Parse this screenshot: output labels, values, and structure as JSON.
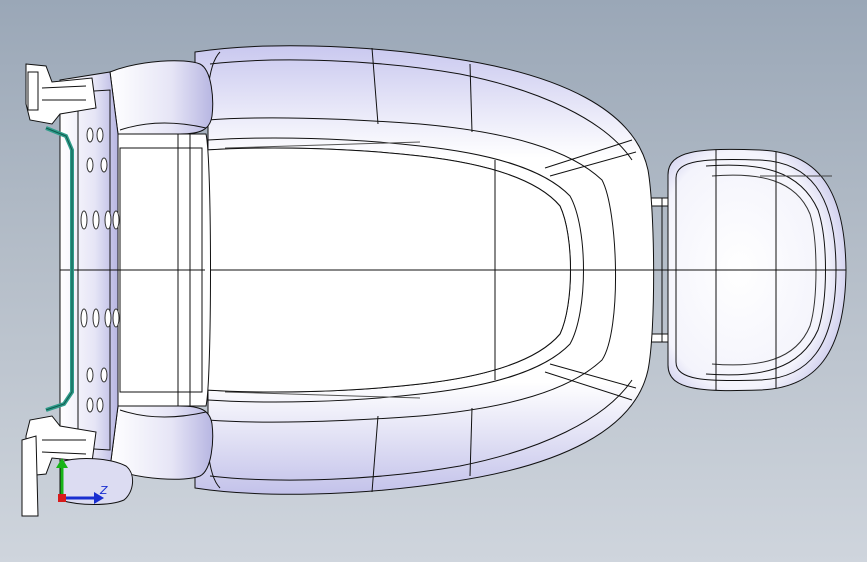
{
  "viewport": {
    "background_top": "#9aa7b7",
    "background_bottom": "#cfd5dd",
    "surface_fill": "#ffffff",
    "shade_color": "#b9b8e6",
    "edge_color": "#111111",
    "accent_teal": "#2f9c8a"
  },
  "model": {
    "parts": [
      "seat-frame",
      "seat-cushion",
      "cushion-bolster",
      "headrest",
      "headrest-posts"
    ],
    "icon": "seat-cad-model"
  },
  "triad": {
    "icon": "coordinate-triad-icon",
    "x_color": "#d81b1b",
    "y_color": "#18b418",
    "z_color": "#1a2fd0",
    "z_label": "Z"
  }
}
